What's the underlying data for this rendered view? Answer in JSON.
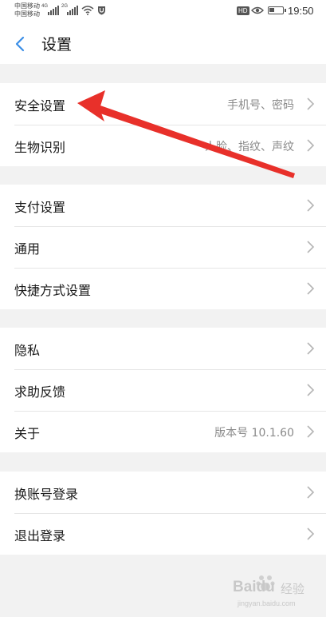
{
  "status_bar": {
    "carrier_line1": "中国移动",
    "carrier_line2": "中国移动",
    "net1": "4G",
    "net2": "2G",
    "hd": "HD",
    "time": "19:50",
    "battery_level": 0.4
  },
  "header": {
    "title": "设置",
    "back_icon": "chevron-left-icon",
    "accent_color": "#3a8ee6"
  },
  "groups": [
    {
      "rows": [
        {
          "label": "安全设置",
          "value": "手机号、密码"
        },
        {
          "label": "生物识别",
          "value": "人脸、指纹、声纹"
        }
      ]
    },
    {
      "rows": [
        {
          "label": "支付设置",
          "value": ""
        },
        {
          "label": "通用",
          "value": ""
        },
        {
          "label": "快捷方式设置",
          "value": ""
        }
      ]
    },
    {
      "rows": [
        {
          "label": "隐私",
          "value": ""
        },
        {
          "label": "求助反馈",
          "value": ""
        },
        {
          "label": "关于",
          "value": "版本号 10.1.60"
        }
      ]
    },
    {
      "rows": [
        {
          "label": "换账号登录",
          "value": ""
        },
        {
          "label": "退出登录",
          "value": ""
        }
      ]
    }
  ],
  "annotation": {
    "arrow_color": "#e8302a"
  },
  "watermark": {
    "brand": "Baidu",
    "sub": "经验",
    "url": "jingyan.baidu.com"
  }
}
